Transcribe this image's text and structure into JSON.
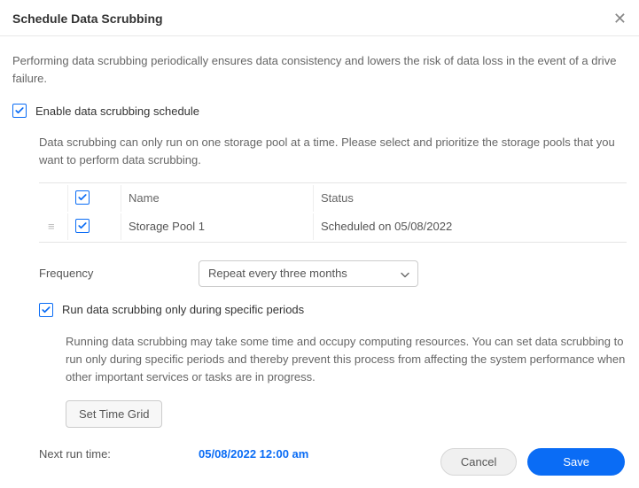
{
  "dialog": {
    "title": "Schedule Data Scrubbing",
    "intro": "Performing data scrubbing periodically ensures data consistency and lowers the risk of data loss in the event of a drive failure."
  },
  "enable": {
    "label": "Enable data scrubbing schedule",
    "checked": true,
    "description": "Data scrubbing can only run on one storage pool at a time. Please select and prioritize the storage pools that you want to perform data scrubbing."
  },
  "table": {
    "header": {
      "name": "Name",
      "status": "Status"
    },
    "rows": [
      {
        "checked": true,
        "name": "Storage Pool 1",
        "status": "Scheduled on 05/08/2022"
      }
    ]
  },
  "frequency": {
    "label": "Frequency",
    "value": "Repeat every three months"
  },
  "specific": {
    "label": "Run data scrubbing only during specific periods",
    "checked": true,
    "description": "Running data scrubbing may take some time and occupy computing resources. You can set data scrubbing to run only during specific periods and thereby prevent this process from affecting the system performance when other important services or tasks are in progress.",
    "button": "Set Time Grid"
  },
  "next_run": {
    "label": "Next run time:",
    "value": "05/08/2022 12:00 am"
  },
  "footer": {
    "cancel": "Cancel",
    "save": "Save"
  }
}
